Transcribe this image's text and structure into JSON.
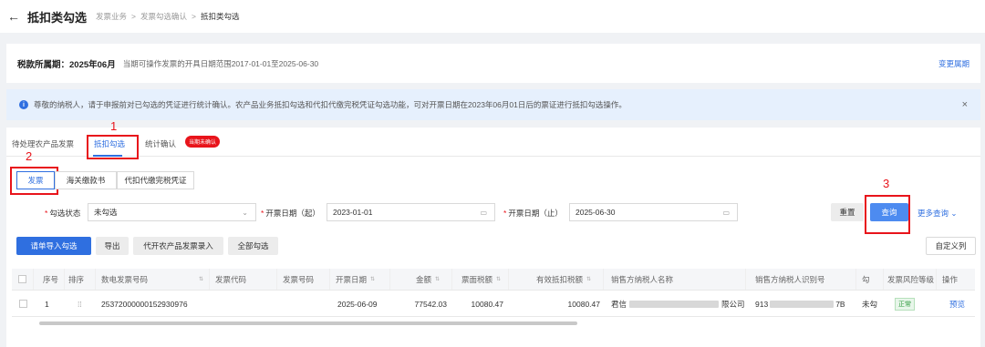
{
  "header": {
    "back_icon": "arrow-left-icon",
    "title": "抵扣类勾选",
    "breadcrumb": [
      "发票业务",
      "发票勾选确认",
      "抵扣类勾选"
    ],
    "sep": ">"
  },
  "period": {
    "label": "税款所属期：2025年06月",
    "hint": "当期可操作发票的开具日期范围2017-01-01至2025-06-30",
    "change_link": "变更属期"
  },
  "notice": {
    "icon": "info-icon",
    "text": "尊敬的纳税人，请于申报前对已勾选的凭证进行统计确认。农产品业务抵扣勾选和代扣代缴完税凭证勾选功能，可对开票日期在2023年06月01日后的票证进行抵扣勾选操作。",
    "close": "×"
  },
  "tabs": [
    {
      "label": "待处理农产品发票"
    },
    {
      "label": "抵扣勾选"
    },
    {
      "label": "统计确认"
    }
  ],
  "tab_badge": "当期未确认",
  "annotations": [
    "1",
    "2",
    "3"
  ],
  "segments": [
    "发票",
    "海关缴款书",
    "代扣代缴完税凭证"
  ],
  "filters": {
    "status_label": "勾选状态",
    "status_value": "未勾选",
    "start_label": "开票日期（起）",
    "start_value": "2023-01-01",
    "end_label": "开票日期（止）",
    "end_value": "2025-06-30",
    "reset": "重置",
    "query": "查询",
    "more": "更多查询 ⌄",
    "req": "*"
  },
  "actions": [
    "请单导入勾选",
    "导出",
    "代开农产品发票录入",
    "全部勾选"
  ],
  "custom_columns": "自定义列",
  "table": {
    "headers": [
      "序号",
      "排序",
      "数电发票号码",
      "发票代码",
      "发票号码",
      "开票日期",
      "金额",
      "票面税额",
      "有效抵扣税额",
      "销售方纳税人名称",
      "销售方纳税人识别号",
      "勾",
      "发票风险等级",
      "操作"
    ],
    "row": {
      "index": "1",
      "drag": "⁞⁞",
      "invoice_no": "25372000000152930976",
      "date": "2025-06-09",
      "amount": "77542.03",
      "tax": "10080.47",
      "deductible": "10080.47",
      "seller_prefix": "君信",
      "seller_suffix": "限公司",
      "seller_id_prefix": "913",
      "seller_id_suffix": "7B",
      "status": "未勾",
      "risk": "正常",
      "action": "预览"
    }
  }
}
